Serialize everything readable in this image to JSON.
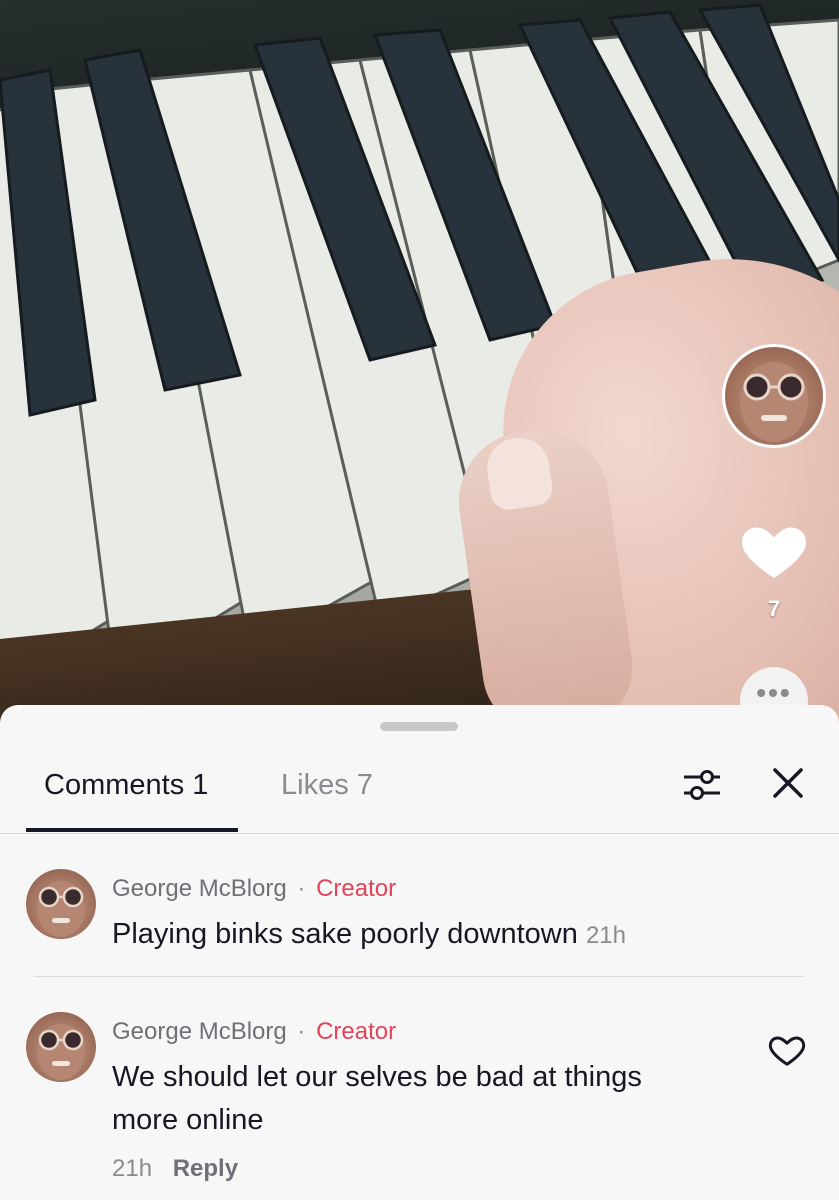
{
  "video": {
    "like_count": "7",
    "more_glyph": "•••"
  },
  "sheet": {
    "tabs": [
      {
        "label": "Comments 1",
        "active": true
      },
      {
        "label": "Likes 7",
        "active": false
      }
    ],
    "icons": {
      "filter": "sliders-icon",
      "close": "close-icon"
    }
  },
  "comments": [
    {
      "author": "George McBlorg",
      "separator": "·",
      "badge": "Creator",
      "text": "Playing binks sake poorly downtown",
      "time": "21h"
    },
    {
      "author": "George McBlorg",
      "separator": "·",
      "badge": "Creator",
      "text": "We should let our selves be bad at things more online",
      "time": "21h",
      "reply_label": "Reply"
    }
  ],
  "colors": {
    "accent_creator": "#e2445c",
    "text_primary": "#161823",
    "text_secondary": "#8a8b91",
    "sheet_bg": "#f7f7f7"
  }
}
